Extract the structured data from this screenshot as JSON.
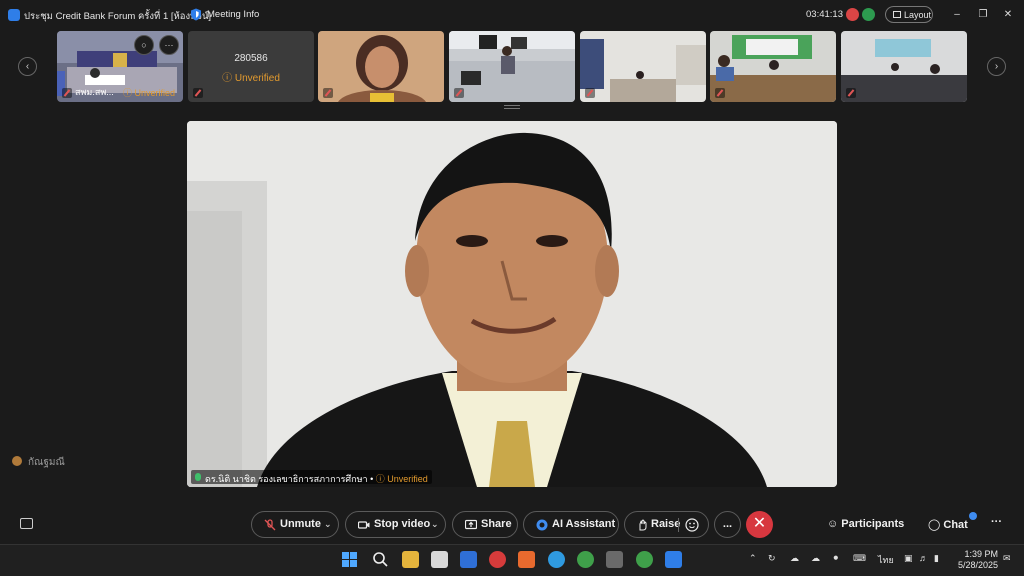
{
  "window": {
    "title": "ประชุม Credit Bank Forum ครั้งที่ 1 [ห้องพจน์]",
    "meeting_info": "Meeting Info",
    "timer": "03:41:13",
    "layout_label": "Layout"
  },
  "thumbnails": [
    {
      "name": "สพม.สพ...",
      "status": "Unverified"
    },
    {
      "name": "280586",
      "status": "Unverified"
    },
    {
      "name": "",
      "status": ""
    },
    {
      "name": "",
      "status": ""
    },
    {
      "name": "",
      "status": ""
    },
    {
      "name": "",
      "status": ""
    },
    {
      "name": "",
      "status": ""
    }
  ],
  "main": {
    "speaker_name": "ดร.นิติ นาชิต รองเลขาธิการสภาการศึกษา",
    "speaker_status": "Unverified"
  },
  "side_participant": "กัณฐมณี",
  "controls": {
    "unmute": "Unmute",
    "stop_video": "Stop video",
    "share": "Share",
    "ai_assistant": "AI Assistant",
    "raise": "Raise",
    "participants": "Participants",
    "chat": "Chat",
    "more": "..."
  },
  "taskbar": {
    "lang": "ไทย",
    "time": "1:39 PM",
    "date": "5/28/2025"
  },
  "colors": {
    "background": "#1b1b1b",
    "unverified": "#e29a2e",
    "end_call": "#d7373f",
    "accent": "#3f8cf0"
  }
}
